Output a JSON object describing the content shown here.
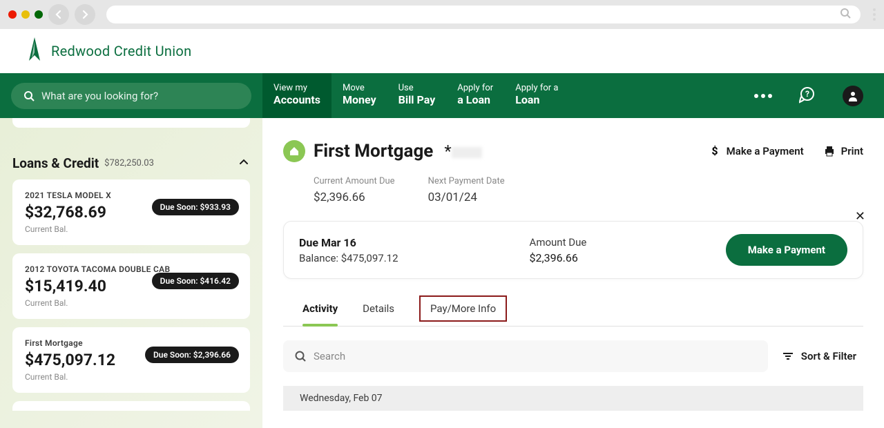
{
  "brand": "Redwood Credit Union",
  "global_search_placeholder": "What are you looking for?",
  "nav": {
    "items": [
      {
        "line1": "View my",
        "line2": "Accounts",
        "active": true
      },
      {
        "line1": "Move",
        "line2": "Money"
      },
      {
        "line1": "Use",
        "line2": "Bill Pay"
      },
      {
        "line1": "Apply for",
        "line2": "a Loan"
      },
      {
        "line1": "Apply for a",
        "line2": "Loan"
      }
    ]
  },
  "sidebar": {
    "section_title": "Loans & Credit",
    "section_total": "$782,250.03",
    "accounts": [
      {
        "name": "2021 TESLA MODEL X",
        "balance": "$32,768.69",
        "label": "Current Bal.",
        "due": "Due Soon: $933.93"
      },
      {
        "name": "2012 TOYOTA TACOMA DOUBLE CAB",
        "balance": "$15,419.40",
        "label": "Current Bal.",
        "due": "Due Soon: $416.42"
      },
      {
        "name": "First Mortgage",
        "balance": "$475,097.12",
        "label": "Current Bal.",
        "due": "Due Soon: $2,396.66"
      }
    ]
  },
  "page": {
    "title": "First Mortgage",
    "mask_prefix": "*",
    "make_payment": "Make a Payment",
    "print": "Print",
    "summary": {
      "current_due_label": "Current Amount Due",
      "current_due_value": "$2,396.66",
      "next_date_label": "Next Payment Date",
      "next_date_value": "03/01/24"
    },
    "alert": {
      "due_label": "Due Mar 16",
      "balance_label": "Balance: $475,097.12",
      "amount_due_label": "Amount Due",
      "amount_due_value": "$2,396.66",
      "button": "Make a Payment"
    },
    "tabs": [
      "Activity",
      "Details",
      "Pay/More Info"
    ],
    "search_placeholder": "Search",
    "sort_filter": "Sort & Filter",
    "date_header": "Wednesday, Feb 07"
  }
}
